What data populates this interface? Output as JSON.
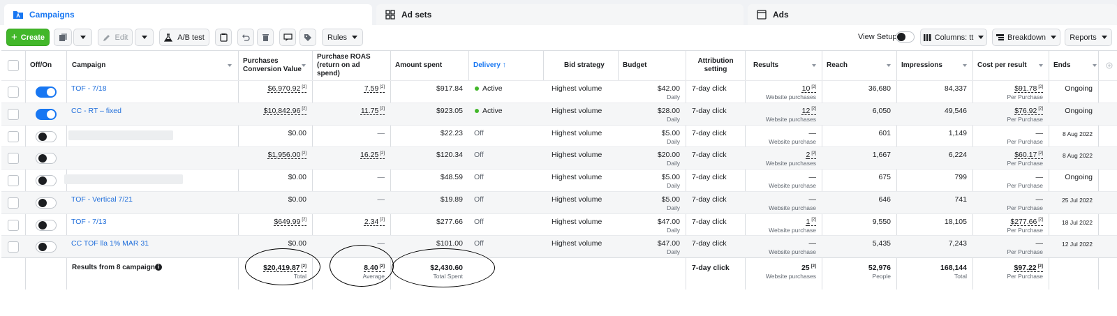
{
  "tabs": [
    {
      "label": "Campaigns",
      "icon": "campaigns-folder-icon"
    },
    {
      "label": "Ad sets",
      "icon": "grid-icon"
    },
    {
      "label": "Ads",
      "icon": "ad-square-icon"
    }
  ],
  "toolbar": {
    "create": "Create",
    "edit": "Edit",
    "ab_test": "A/B test",
    "rules": "Rules",
    "view_setup": "View Setup",
    "columns": "Columns: tt",
    "breakdown": "Breakdown",
    "reports": "Reports"
  },
  "colors": {
    "accent": "#1877f2",
    "create": "#42b72a",
    "link": "#216fdb",
    "active_dot": "#42b72a"
  },
  "headers": {
    "off_on": "Off/On",
    "campaign": "Campaign",
    "conv_value_1": "Purchases",
    "conv_value_2": "Conversion Value",
    "roas_1": "Purchase ROAS",
    "roas_2": "(return on ad",
    "roas_3": "spend)",
    "amount_spent": "Amount spent",
    "delivery": "Delivery ↑",
    "bid_strategy": "Bid strategy",
    "budget": "Budget",
    "attribution_1": "Attribution",
    "attribution_2": "setting",
    "results": "Results",
    "reach": "Reach",
    "impressions": "Impressions",
    "cost_per_result": "Cost per result",
    "ends": "Ends"
  },
  "rows": [
    {
      "toggle": "on",
      "name": "TOF - 7/18",
      "conv_value": "$6,970.92",
      "roas": "7.59",
      "spent": "$917.84",
      "delivery": "Active",
      "bid": "Highest volume",
      "budget": "$42.00",
      "budget_sub": "Daily",
      "attribution": "7-day click",
      "results": "10",
      "results_sub": "Website purchases",
      "reach": "36,680",
      "impressions": "84,337",
      "cpr": "$91.78",
      "cpr_sub": "Per Purchase",
      "ends": "Ongoing"
    },
    {
      "toggle": "on",
      "name": "CC - RT – fixed",
      "conv_value": "$10,842.96",
      "roas": "11.75",
      "spent": "$923.05",
      "delivery": "Active",
      "bid": "Highest volume",
      "budget": "$28.00",
      "budget_sub": "Daily",
      "attribution": "7-day click",
      "results": "12",
      "results_sub": "Website purchases",
      "reach": "6,050",
      "impressions": "49,546",
      "cpr": "$76.92",
      "cpr_sub": "Per Purchase",
      "ends": "Ongoing"
    },
    {
      "toggle": "off",
      "name": "",
      "conv_value": "$0.00",
      "roas": "—",
      "spent": "$22.23",
      "delivery": "Off",
      "bid": "Highest volume",
      "budget": "$5.00",
      "budget_sub": "Daily",
      "attribution": "7-day click",
      "results": "—",
      "results_sub": "Website purchase",
      "reach": "601",
      "impressions": "1,149",
      "cpr": "—",
      "cpr_sub": "Per Purchase",
      "ends": "8 Aug 2022"
    },
    {
      "toggle": "off",
      "name": "",
      "conv_value": "$1,956.00",
      "roas": "16.25",
      "spent": "$120.34",
      "delivery": "Off",
      "bid": "Highest volume",
      "budget": "$20.00",
      "budget_sub": "Daily",
      "attribution": "7-day click",
      "results": "2",
      "results_sub": "Website purchases",
      "reach": "1,667",
      "impressions": "6,224",
      "cpr": "$60.17",
      "cpr_sub": "Per Purchase",
      "ends": "8 Aug 2022"
    },
    {
      "toggle": "off",
      "name": "",
      "conv_value": "$0.00",
      "roas": "—",
      "spent": "$48.59",
      "delivery": "Off",
      "bid": "Highest volume",
      "budget": "$5.00",
      "budget_sub": "Daily",
      "attribution": "7-day click",
      "results": "—",
      "results_sub": "Website purchase",
      "reach": "675",
      "impressions": "799",
      "cpr": "—",
      "cpr_sub": "Per Purchase",
      "ends": "Ongoing"
    },
    {
      "toggle": "off",
      "name": "TOF - Vertical 7/21",
      "conv_value": "$0.00",
      "roas": "—",
      "spent": "$19.89",
      "delivery": "Off",
      "bid": "Highest volume",
      "budget": "$5.00",
      "budget_sub": "Daily",
      "attribution": "7-day click",
      "results": "—",
      "results_sub": "Website purchase",
      "reach": "646",
      "impressions": "741",
      "cpr": "—",
      "cpr_sub": "Per Purchase",
      "ends": "25 Jul 2022"
    },
    {
      "toggle": "off",
      "name": "TOF - 7/13",
      "conv_value": "$649.99",
      "roas": "2.34",
      "spent": "$277.66",
      "delivery": "Off",
      "bid": "Highest volume",
      "budget": "$47.00",
      "budget_sub": "Daily",
      "attribution": "7-day click",
      "results": "1",
      "results_sub": "Website purchase",
      "reach": "9,550",
      "impressions": "18,105",
      "cpr": "$277.66",
      "cpr_sub": "Per Purchase",
      "ends": "18 Jul 2022"
    },
    {
      "toggle": "off",
      "name": "CC TOF lla 1% MAR 31",
      "conv_value": "$0.00",
      "roas": "—",
      "spent": "$101.00",
      "delivery": "Off",
      "bid": "Highest volume",
      "budget": "$47.00",
      "budget_sub": "Daily",
      "attribution": "7-day click",
      "results": "—",
      "results_sub": "Website purchase",
      "reach": "5,435",
      "impressions": "7,243",
      "cpr": "—",
      "cpr_sub": "Per Purchase",
      "ends": "12 Jul 2022"
    }
  ],
  "summary": {
    "label": "Results from 8 campaigns",
    "conv_value": "$20,419.87",
    "conv_value_sub": "Total",
    "roas": "8.40",
    "roas_sub": "Average",
    "spent": "$2,430.60",
    "spent_sub": "Total Spent",
    "attribution": "7-day click",
    "results": "25",
    "results_sub": "Website purchases",
    "reach": "52,976",
    "reach_sub": "People",
    "impressions": "168,144",
    "impressions_sub": "Total",
    "cpr": "$97.22",
    "cpr_sub": "Per Purchase"
  }
}
